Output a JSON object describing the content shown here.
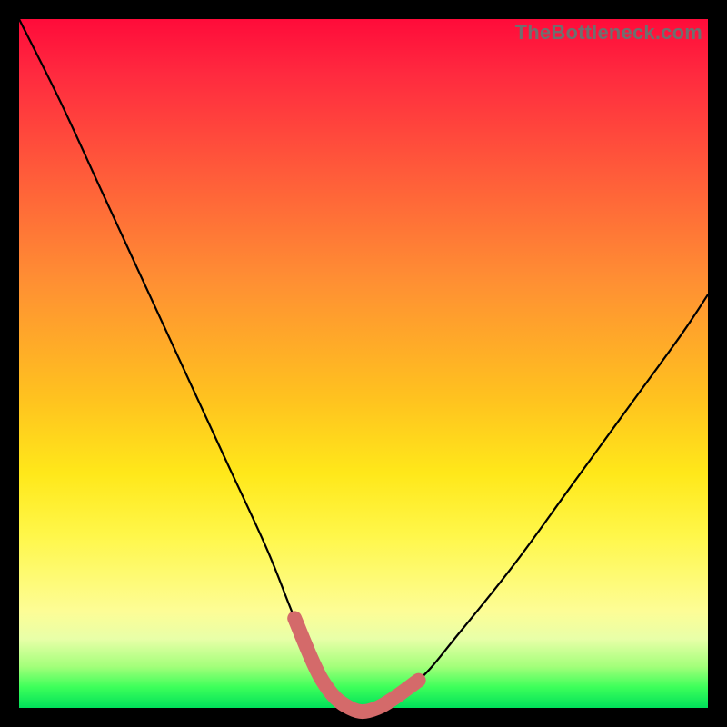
{
  "watermark": "TheBottleneck.com",
  "chart_data": {
    "type": "line",
    "title": "",
    "xlabel": "",
    "ylabel": "",
    "xlim": [
      0,
      100
    ],
    "ylim": [
      0,
      100
    ],
    "series": [
      {
        "name": "bottleneck-curve",
        "x": [
          0,
          6,
          12,
          18,
          24,
          30,
          36,
          40,
          44,
          48,
          52,
          58,
          64,
          72,
          80,
          88,
          96,
          100
        ],
        "values": [
          100,
          88,
          75,
          62,
          49,
          36,
          23,
          13,
          4,
          0,
          0,
          4,
          11,
          21,
          32,
          43,
          54,
          60
        ],
        "color": "#000000"
      },
      {
        "name": "highlight-band",
        "x": [
          40,
          44,
          48,
          52,
          58
        ],
        "values": [
          13,
          4,
          0,
          0,
          4
        ],
        "color": "#d46a6a"
      }
    ],
    "annotations": []
  }
}
